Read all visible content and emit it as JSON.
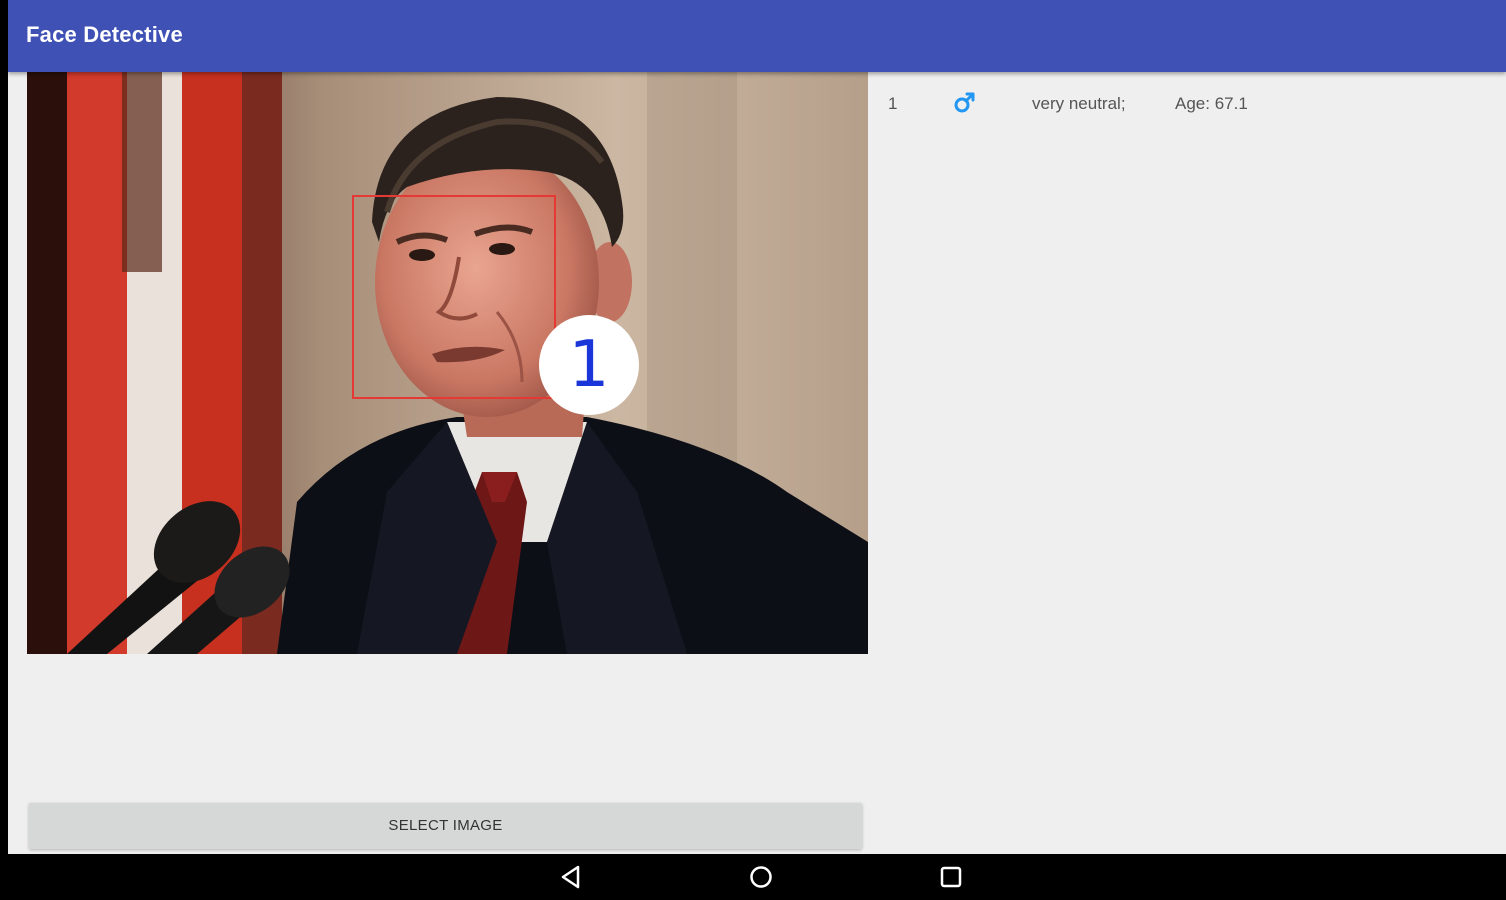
{
  "app": {
    "title": "Face Detective",
    "accent_color": "#3f51b5"
  },
  "photo": {
    "faces": [
      {
        "label": "1",
        "box_color": "#e53935"
      }
    ]
  },
  "results": {
    "rows": [
      {
        "index": "1",
        "gender_icon": "male-symbol-icon",
        "emotion": "very neutral;",
        "age": "Age: 67.1"
      }
    ]
  },
  "actions": {
    "select_image_label": "SELECT IMAGE"
  },
  "navbar": {
    "icons": [
      "back-icon",
      "home-icon",
      "recent-apps-icon"
    ]
  }
}
